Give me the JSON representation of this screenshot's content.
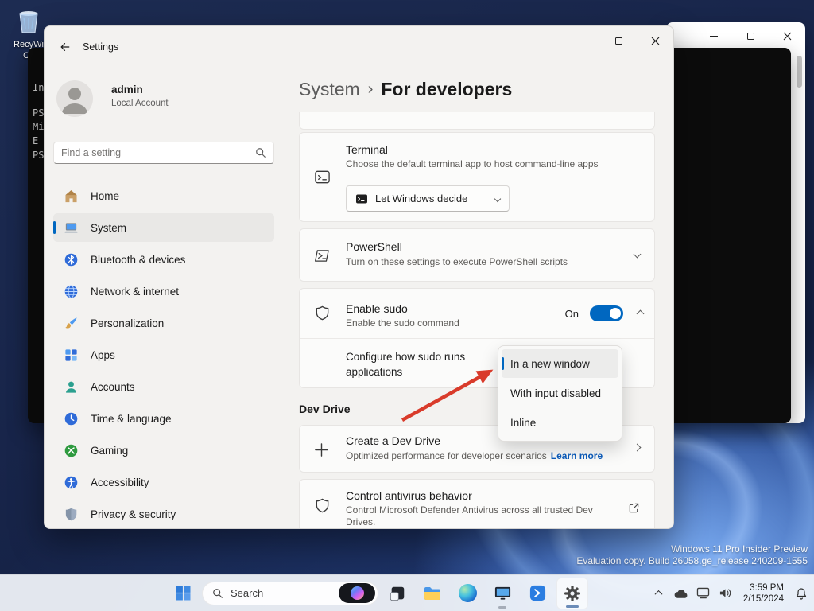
{
  "colors": {
    "accent": "#0067c0",
    "hyperlink": "#0b5cbd",
    "arrow_red": "#d93b2b",
    "toggle_on": "#0067c0"
  },
  "desktop": {
    "recycle_bin_label_1": "RecyWi",
    "recycle_bin_label_2": "Co",
    "watermark": {
      "line1": "Windows 11 Pro Insider Preview",
      "line2": "Evaluation copy. Build 26058.ge_release.240209-1555"
    }
  },
  "terminal": {
    "lines": {
      "l1": "In",
      "l2": "PS",
      "l3": "Mic PS",
      "l4": "E Su",
      "l5": "PS"
    }
  },
  "settings": {
    "title": "Settings",
    "account": {
      "name": "admin",
      "type": "Local Account"
    },
    "search_placeholder": "Find a setting",
    "nav": [
      {
        "label": "Home"
      },
      {
        "label": "System"
      },
      {
        "label": "Bluetooth & devices"
      },
      {
        "label": "Network & internet"
      },
      {
        "label": "Personalization"
      },
      {
        "label": "Apps"
      },
      {
        "label": "Accounts"
      },
      {
        "label": "Time & language"
      },
      {
        "label": "Gaming"
      },
      {
        "label": "Accessibility"
      },
      {
        "label": "Privacy & security"
      }
    ],
    "breadcrumb": {
      "parent": "System",
      "separator": "›",
      "current": "For developers"
    },
    "terminal_card": {
      "title": "Terminal",
      "description": "Choose the default terminal app to host command-line apps",
      "dropdown_value": "Let Windows decide"
    },
    "powershell_card": {
      "title": "PowerShell",
      "description": "Turn on these settings to execute PowerShell scripts"
    },
    "sudo_card": {
      "title": "Enable sudo",
      "description": "Enable the sudo command",
      "toggle_state": "On",
      "config_label": "Configure how sudo runs applications"
    },
    "sudo_dropdown": {
      "options": [
        {
          "label": "In a new window",
          "selected": true
        },
        {
          "label": "With input disabled",
          "selected": false
        },
        {
          "label": "Inline",
          "selected": false
        }
      ]
    },
    "dev_drive_section": "Dev Drive",
    "create_dev_drive_card": {
      "title": "Create a Dev Drive",
      "description": "Optimized performance for developer scenarios",
      "link": "Learn more"
    },
    "antivirus_card": {
      "title": "Control antivirus behavior",
      "description": "Control Microsoft Defender Antivirus across all trusted Dev Drives."
    }
  },
  "taskbar": {
    "search_label": "Search",
    "clock": {
      "time": "3:59 PM",
      "date": "2/15/2024"
    }
  }
}
